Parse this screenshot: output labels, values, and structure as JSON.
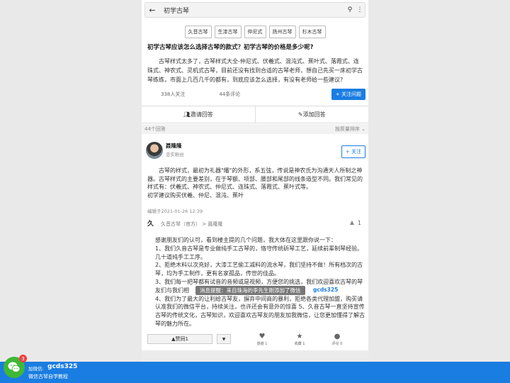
{
  "search": {
    "query": "初学古琴"
  },
  "tags": [
    "久音古琴",
    "生漆古琴",
    "仲尼式",
    "扬州古琴",
    "杉木古琴"
  ],
  "question": {
    "title": "初学古琴应该怎么选择古琴的款式？初学古琴的价格是多少呢?",
    "body": "古琴样式太多了，古琴样式大全-仲尼式、伏羲式、混沌式、蕉叶式、落霞式、连珠式、神农式、灵机式古琴，目前还没有找到合适的古琴老师，想自己先买一床初学古琴练练，市面上几百几千的都有，到底应该怎么选择，有没有老师给一些建议?",
    "followers": "338人关注",
    "comments": "44条评论",
    "follow_label": "+ 关注问题"
  },
  "actions": {
    "invite": "邀请回答",
    "add": "添加回答"
  },
  "answers": {
    "count": "44个回答",
    "sort": "按质量排序"
  },
  "answer": {
    "author": "聂隆隆",
    "author_sub": "忠实粉丝",
    "follow_label": "+ 关注",
    "para1": "古琴的样式，最初为礼器\"皤\"的外形，系五弦，传说是神农氏为沟通天人所制之神器。古琴样式的主要差别，在于琴额、项部、腰部和尾部的线条造型不同。我们常见的样式有：伏羲式、神农式、仲尼式、连珠式、落霞式、蕉叶式等。",
    "para2": "初学建议购买伏羲、仲尼、混沌、蕉叶",
    "edited": "编辑于2021-01-26 12:39"
  },
  "reply": {
    "logo": "久",
    "author": "久音古琴（官方） > 聂隆隆",
    "likes": "1",
    "lines": [
      "感谢朋友们的认可，看到楼主提的几个问题，我大体在这里跟你说一下：",
      "1、我们久音古琴是专业做纯手工古琴的，恪守传统斫琴工艺，延续前辈制琴经验。几十道纯手工工序。",
      "2、拒绝木料以次充好，大漆工艺偷工减料的流水琴，我们坚持不做！所有档次的古琴，均为手工制作，更有名家孤品，传世的佳品。",
      "3、我们每一把琴都有试音的音频或是视频，方便您的挑选，我们欢迎喜欢古琴的琴友们与我们相",
      "4、我们为了最大的让利给古琴友，摒弃中间商的暴利，拒绝各类代理加盟，购买请认准我们的微信平台，持续关注，也许还会有意外的惊喜 5、久音古琴一直坚持宣传古琴的传统文化，古琴知识，欢迎喜欢古琴友的朋友加我微信，让您更加懂得了解古琴的魅力所在。"
    ],
    "toast": "消息提醒：来自珠海的李先生刚添加了微信",
    "toast_tail": "gcds325",
    "vote": "赞同1",
    "btn_thanks": "感谢 1",
    "btn_collect": "收藏 1",
    "btn_comment": "评论 0"
  },
  "footer": {
    "badge": "3",
    "wx_label": "加微信:",
    "wx_id": "gcds325",
    "sub": "微信古琴自学教程"
  },
  "colors": {
    "accent": "#1a7de2",
    "wechat": "#3fb836",
    "badge": "#f04040"
  }
}
